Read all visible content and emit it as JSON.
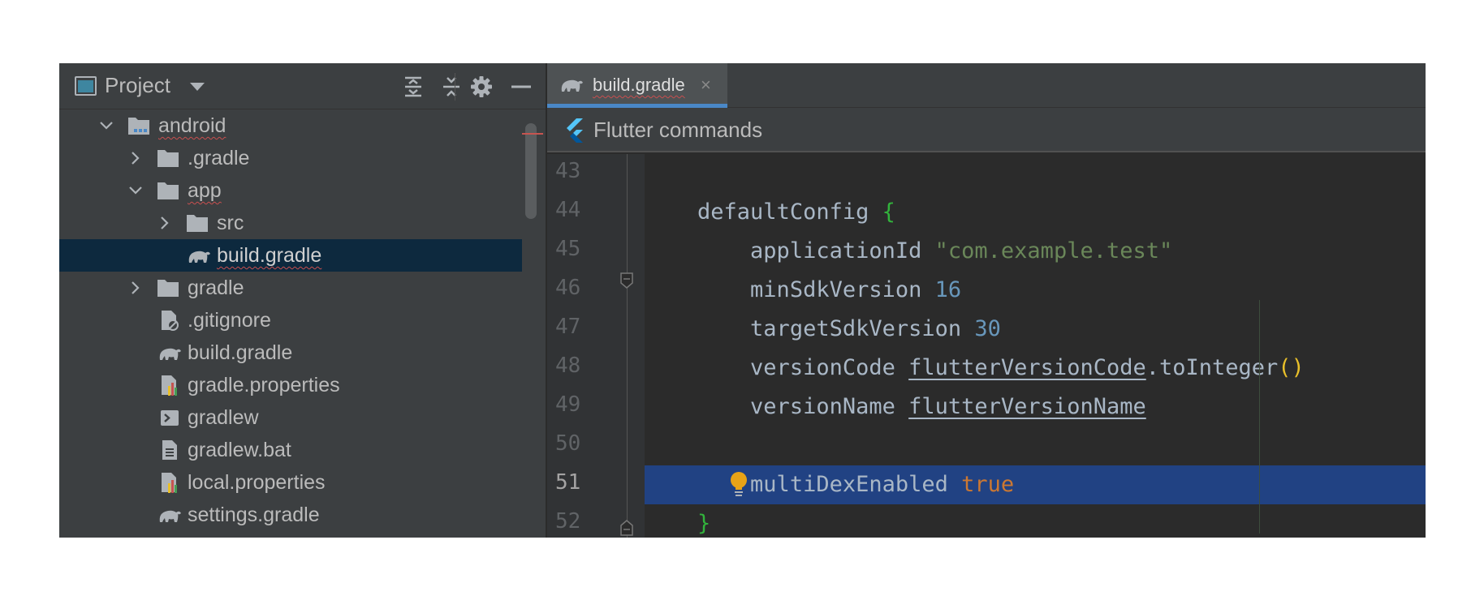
{
  "project_panel": {
    "title": "Project",
    "tree": [
      {
        "label": "android",
        "icon": "module-folder-icon",
        "state": "expanded",
        "squiggle": true
      },
      {
        "label": ".gradle",
        "icon": "folder-icon",
        "state": "collapsed"
      },
      {
        "label": "app",
        "icon": "folder-icon",
        "state": "expanded",
        "squiggle": true
      },
      {
        "label": "src",
        "icon": "folder-icon",
        "state": "collapsed"
      },
      {
        "label": "build.gradle",
        "icon": "gradle-elephant-icon",
        "selected": true,
        "squiggle": true
      },
      {
        "label": "gradle",
        "icon": "folder-icon",
        "state": "collapsed"
      },
      {
        "label": ".gitignore",
        "icon": "ignored-file-icon"
      },
      {
        "label": "build.gradle",
        "icon": "gradle-elephant-icon"
      },
      {
        "label": "gradle.properties",
        "icon": "properties-file-icon"
      },
      {
        "label": "gradlew",
        "icon": "shell-script-icon"
      },
      {
        "label": "gradlew.bat",
        "icon": "text-file-icon"
      },
      {
        "label": "local.properties",
        "icon": "properties-file-icon"
      },
      {
        "label": "settings.gradle",
        "icon": "gradle-elephant-icon"
      }
    ]
  },
  "editor": {
    "tab": {
      "label": "build.gradle",
      "close": "×"
    },
    "flutter_bar": {
      "label": "Flutter commands"
    },
    "current_line": "51",
    "lines": [
      {
        "num": "43",
        "text": ""
      },
      {
        "num": "44",
        "text": "    defaultConfig {"
      },
      {
        "num": "45",
        "text": "        applicationId \"com.example.test\""
      },
      {
        "num": "46",
        "text": "        minSdkVersion 16"
      },
      {
        "num": "47",
        "text": "        targetSdkVersion 30"
      },
      {
        "num": "48",
        "text": "        versionCode flutterVersionCode.toInteger()"
      },
      {
        "num": "49",
        "text": "        versionName flutterVersionName"
      },
      {
        "num": "50",
        "text": ""
      },
      {
        "num": "51",
        "text": "        multiDexEnabled true"
      },
      {
        "num": "52",
        "text": "    }"
      }
    ],
    "tokens": {
      "defaultConfig": "defaultConfig",
      "open_brace": "{",
      "applicationId": "applicationId",
      "app_id_value": "\"com.example.test\"",
      "minSdkVersion": "minSdkVersion",
      "min_sdk": "16",
      "targetSdkVersion": "targetSdkVersion",
      "target_sdk": "30",
      "versionCode": "versionCode",
      "flutterVersionCode": "flutterVersionCode",
      "toInteger": ".toInteger",
      "parens": "()",
      "versionName": "versionName",
      "flutterVersionName": "flutterVersionName",
      "multiDexEnabled": "multiDexEnabled",
      "true_kw": "true",
      "close_brace": "}"
    }
  },
  "colors": {
    "panel_bg": "#3c3f41",
    "editor_bg": "#2b2b2b",
    "selection": "#0d293e",
    "line_highlight": "#214283",
    "keyword": "#cc7832",
    "number": "#6897bb",
    "string": "#6a8759",
    "tab_underline": "#4a88c7"
  }
}
